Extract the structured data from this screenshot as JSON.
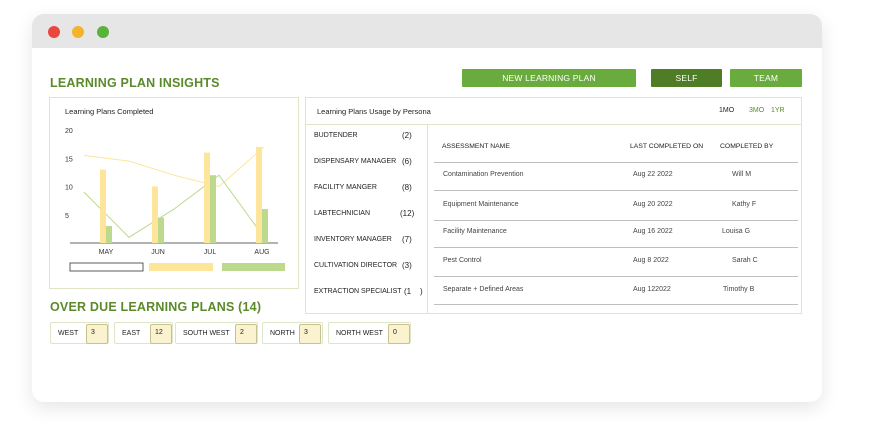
{
  "window": {
    "controls": [
      "close",
      "minimize",
      "maximize"
    ]
  },
  "header": {
    "title": "LEARNING PLAN INSIGHTS",
    "buttons": {
      "new_plan": "NEW LEARNING PLAN",
      "self": "SELF",
      "team": "TEAM"
    }
  },
  "colors": {
    "accent": "#6aab3d",
    "dark_accent": "#4f7d25",
    "bar_yellow": "#fde59b",
    "bar_green": "#bcd98e"
  },
  "chart": {
    "title": "Learning Plans Completed"
  },
  "chart_data": {
    "type": "bar",
    "title": "Learning Plans Completed",
    "categories": [
      "MAY",
      "JUN",
      "JUL",
      "AUG"
    ],
    "y_ticks": [
      "20",
      "15",
      "10",
      "5"
    ],
    "ylim": [
      0,
      20
    ],
    "series": [
      {
        "color": "#fde59b",
        "values": [
          13,
          10,
          16,
          17
        ]
      },
      {
        "color": "#bcd98e",
        "values": [
          3,
          4.5,
          12,
          6
        ]
      }
    ],
    "trend_lines": [
      {
        "color": "#fde59b",
        "values": [
          15.5,
          14.5,
          12,
          10,
          17
        ]
      },
      {
        "color": "#bcd98e",
        "values": [
          9,
          1,
          6,
          12,
          1
        ]
      }
    ],
    "legend": "bottom"
  },
  "persona": {
    "title": "Learning Plans Usage by Persona",
    "ranges": [
      "1MO",
      "3MO",
      "1YR"
    ],
    "roles": [
      {
        "name": "BUDTENDER",
        "count": "(2)"
      },
      {
        "name": "DISPENSARY MANAGER",
        "count": "(6)"
      },
      {
        "name": "FACILITY MANGER",
        "count": "(8)"
      },
      {
        "name": "LABTECHNICIAN",
        "count": "(12)"
      },
      {
        "name": "INVENTORY MANAGER",
        "count": "(7)"
      },
      {
        "name": "CULTIVATION DIRECTOR",
        "count": "(3)"
      },
      {
        "name": "EXTRACTION SPECIALIST",
        "count": "(1    )"
      }
    ],
    "columns": [
      "ASSESSMENT NAME",
      "LAST COMPLETED ON",
      "COMPLETED BY"
    ],
    "rows": [
      [
        "Contamination Prevention",
        "Aug 22 2022",
        "Will M"
      ],
      [
        "Equipment Maintenance",
        "Aug 20 2022",
        "Kathy F"
      ],
      [
        "Facility Maintenance",
        "Aug 16 2022",
        "Louisa G"
      ],
      [
        "Pest Control",
        "Aug 8 2022",
        "Sarah C"
      ],
      [
        "Separate + Defined Areas",
        "Aug 122022",
        "Timothy B"
      ]
    ]
  },
  "overdue": {
    "title": "OVER DUE LEARNING PLANS (14)",
    "regions": [
      {
        "name": "WEST",
        "count": "3"
      },
      {
        "name": "EAST",
        "count": "12"
      },
      {
        "name": "SOUTH WEST",
        "count": "2"
      },
      {
        "name": "NORTH",
        "count": "3"
      },
      {
        "name": "NORTH WEST",
        "count": "0"
      }
    ]
  }
}
